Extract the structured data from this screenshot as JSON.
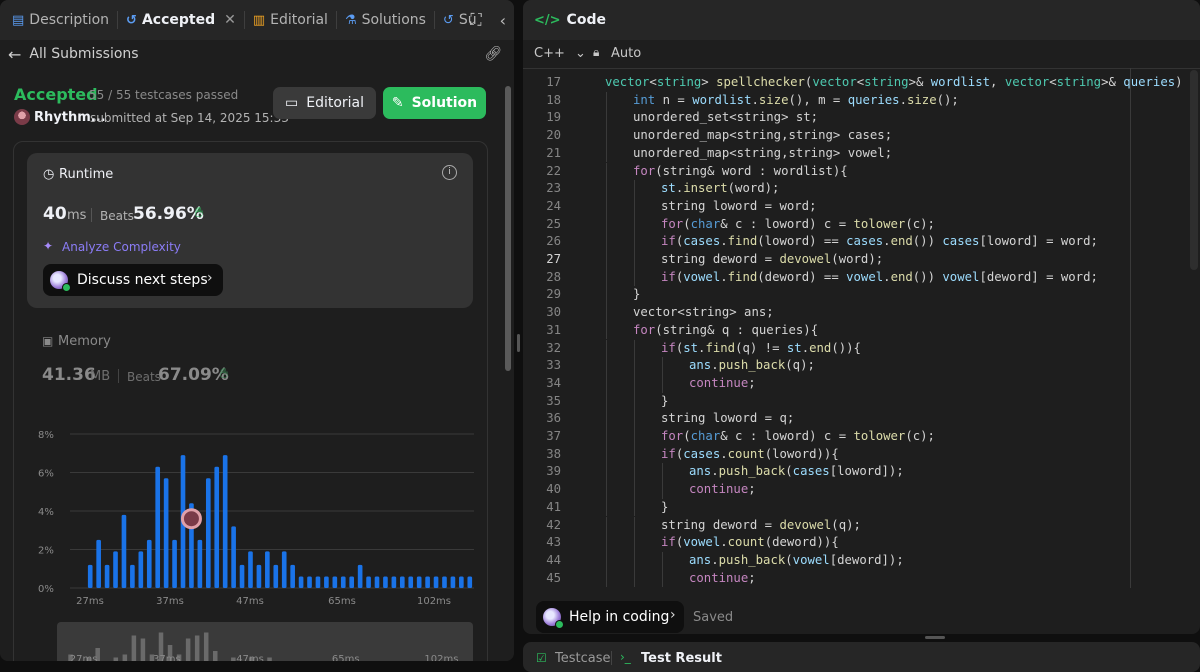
{
  "tabs": {
    "description": "Description",
    "accepted": "Accepted",
    "editorial": "Editorial",
    "solutions": "Solutions",
    "submissions": "Su"
  },
  "left": {
    "back_label": "All Submissions",
    "status": "Accepted",
    "testcases": "55 / 55 testcases passed",
    "user": "Rhythm...",
    "submitted_at": "submitted at Sep 14, 2025 15:33",
    "editorial_button": "Editorial",
    "solution_button": "Solution",
    "runtime": {
      "title": "Runtime",
      "value": "40",
      "unit": "ms",
      "beats_label": "Beats",
      "beats_value": "56.96%",
      "analyze": "Analyze Complexity",
      "discuss": "Discuss next steps"
    },
    "memory": {
      "title": "Memory",
      "value": "41.36",
      "unit": "MB",
      "beats_label": "Beats",
      "beats_value": "67.09%"
    }
  },
  "chart_data": {
    "type": "bar",
    "ylabel": "",
    "xlabel": "",
    "y_ticks": [
      "8%",
      "6%",
      "4%",
      "2%",
      "0%"
    ],
    "ylim": [
      0,
      8
    ],
    "x_ticks": [
      "27ms",
      "37ms",
      "47ms",
      "65ms",
      "102ms"
    ],
    "values": [
      1.2,
      2.5,
      1.2,
      1.9,
      3.8,
      1.2,
      1.9,
      2.5,
      6.3,
      5.7,
      2.5,
      6.9,
      4.4,
      2.5,
      5.7,
      6.3,
      6.9,
      3.2,
      1.2,
      1.9,
      1.2,
      1.9,
      1.2,
      1.9,
      1.2,
      0.6,
      0.6,
      0.6,
      0.6,
      0.6,
      0.6,
      0.6,
      1.2,
      0.6,
      0.6,
      0.6,
      0.6,
      0.6,
      0.6,
      0.6,
      0.6,
      0.6,
      0.6,
      0.6,
      0.6,
      0.6
    ],
    "highlight_index": 15,
    "color": "#1a73e8"
  },
  "code_panel": {
    "title": "Code",
    "language": "C++",
    "mode": "Auto",
    "help": "Help in coding",
    "saved": "Saved",
    "current_line": 27,
    "lines": [
      {
        "n": 17,
        "indent": 1,
        "tokens": [
          [
            "ty",
            "vector"
          ],
          [
            "pl",
            "<"
          ],
          [
            "ty",
            "string"
          ],
          [
            "pl",
            "> "
          ],
          [
            "fn",
            "spellchecker"
          ],
          [
            "pl",
            "("
          ],
          [
            "ty",
            "vector"
          ],
          [
            "pl",
            "<"
          ],
          [
            "ty",
            "string"
          ],
          [
            "pl",
            ">& "
          ],
          [
            "vr",
            "wordlist"
          ],
          [
            "pl",
            ", "
          ],
          [
            "ty",
            "vector"
          ],
          [
            "pl",
            "<"
          ],
          [
            "ty",
            "string"
          ],
          [
            "pl",
            ">& "
          ],
          [
            "vr",
            "queries"
          ],
          [
            "pl",
            ") {"
          ]
        ]
      },
      {
        "n": 18,
        "indent": 2,
        "tokens": [
          [
            "kw",
            "int"
          ],
          [
            "pl",
            " n = "
          ],
          [
            "vr",
            "wordlist"
          ],
          [
            "pl",
            "."
          ],
          [
            "fn",
            "size"
          ],
          [
            "pl",
            "(), m = "
          ],
          [
            "vr",
            "queries"
          ],
          [
            "pl",
            "."
          ],
          [
            "fn",
            "size"
          ],
          [
            "pl",
            "();"
          ]
        ]
      },
      {
        "n": 19,
        "indent": 2,
        "tokens": [
          [
            "pl",
            "unordered_set<string> st;"
          ]
        ]
      },
      {
        "n": 20,
        "indent": 2,
        "tokens": [
          [
            "pl",
            "unordered_map<string,string> cases;"
          ]
        ]
      },
      {
        "n": 21,
        "indent": 2,
        "tokens": [
          [
            "pl",
            "unordered_map<string,string> vowel;"
          ]
        ]
      },
      {
        "n": 22,
        "indent": 2,
        "tokens": [
          [
            "ct",
            "for"
          ],
          [
            "pl",
            "(string& word : wordlist){"
          ]
        ]
      },
      {
        "n": 23,
        "indent": 3,
        "tokens": [
          [
            "vr",
            "st"
          ],
          [
            "pl",
            "."
          ],
          [
            "fn",
            "insert"
          ],
          [
            "pl",
            "(word);"
          ]
        ]
      },
      {
        "n": 24,
        "indent": 3,
        "tokens": [
          [
            "pl",
            "string loword = word;"
          ]
        ]
      },
      {
        "n": 25,
        "indent": 3,
        "tokens": [
          [
            "ct",
            "for"
          ],
          [
            "pl",
            "("
          ],
          [
            "kw",
            "char"
          ],
          [
            "pl",
            "& c : loword) c = "
          ],
          [
            "fn",
            "tolower"
          ],
          [
            "pl",
            "(c);"
          ]
        ]
      },
      {
        "n": 26,
        "indent": 3,
        "tokens": [
          [
            "ct",
            "if"
          ],
          [
            "pl",
            "("
          ],
          [
            "vr",
            "cases"
          ],
          [
            "pl",
            "."
          ],
          [
            "fn",
            "find"
          ],
          [
            "pl",
            "(loword) == "
          ],
          [
            "vr",
            "cases"
          ],
          [
            "pl",
            "."
          ],
          [
            "fn",
            "end"
          ],
          [
            "pl",
            "()) "
          ],
          [
            "vr",
            "cases"
          ],
          [
            "pl",
            "[loword] = word;"
          ]
        ]
      },
      {
        "n": 27,
        "indent": 3,
        "tokens": [
          [
            "pl",
            "string deword = "
          ],
          [
            "fn",
            "devowel"
          ],
          [
            "pl",
            "(word);"
          ]
        ]
      },
      {
        "n": 28,
        "indent": 3,
        "tokens": [
          [
            "ct",
            "if"
          ],
          [
            "pl",
            "("
          ],
          [
            "vr",
            "vowel"
          ],
          [
            "pl",
            "."
          ],
          [
            "fn",
            "find"
          ],
          [
            "pl",
            "(deword) == "
          ],
          [
            "vr",
            "vowel"
          ],
          [
            "pl",
            "."
          ],
          [
            "fn",
            "end"
          ],
          [
            "pl",
            "()) "
          ],
          [
            "vr",
            "vowel"
          ],
          [
            "pl",
            "[deword] = word;"
          ]
        ]
      },
      {
        "n": 29,
        "indent": 2,
        "tokens": [
          [
            "pl",
            "}"
          ]
        ]
      },
      {
        "n": 30,
        "indent": 2,
        "tokens": [
          [
            "pl",
            "vector<string> ans;"
          ]
        ]
      },
      {
        "n": 31,
        "indent": 2,
        "tokens": [
          [
            "ct",
            "for"
          ],
          [
            "pl",
            "(string& q : queries){"
          ]
        ]
      },
      {
        "n": 32,
        "indent": 3,
        "tokens": [
          [
            "ct",
            "if"
          ],
          [
            "pl",
            "("
          ],
          [
            "vr",
            "st"
          ],
          [
            "pl",
            "."
          ],
          [
            "fn",
            "find"
          ],
          [
            "pl",
            "(q) != "
          ],
          [
            "vr",
            "st"
          ],
          [
            "pl",
            "."
          ],
          [
            "fn",
            "end"
          ],
          [
            "pl",
            "()){"
          ]
        ]
      },
      {
        "n": 33,
        "indent": 4,
        "tokens": [
          [
            "vr",
            "ans"
          ],
          [
            "pl",
            "."
          ],
          [
            "fn",
            "push_back"
          ],
          [
            "pl",
            "(q);"
          ]
        ]
      },
      {
        "n": 34,
        "indent": 4,
        "tokens": [
          [
            "ct",
            "continue"
          ],
          [
            "pl",
            ";"
          ]
        ]
      },
      {
        "n": 35,
        "indent": 3,
        "tokens": [
          [
            "pl",
            "}"
          ]
        ]
      },
      {
        "n": 36,
        "indent": 3,
        "tokens": [
          [
            "pl",
            "string loword = q;"
          ]
        ]
      },
      {
        "n": 37,
        "indent": 3,
        "tokens": [
          [
            "ct",
            "for"
          ],
          [
            "pl",
            "("
          ],
          [
            "kw",
            "char"
          ],
          [
            "pl",
            "& c : loword) c = "
          ],
          [
            "fn",
            "tolower"
          ],
          [
            "pl",
            "(c);"
          ]
        ]
      },
      {
        "n": 38,
        "indent": 3,
        "tokens": [
          [
            "ct",
            "if"
          ],
          [
            "pl",
            "("
          ],
          [
            "vr",
            "cases"
          ],
          [
            "pl",
            "."
          ],
          [
            "fn",
            "count"
          ],
          [
            "pl",
            "(loword)){"
          ]
        ]
      },
      {
        "n": 39,
        "indent": 4,
        "tokens": [
          [
            "vr",
            "ans"
          ],
          [
            "pl",
            "."
          ],
          [
            "fn",
            "push_back"
          ],
          [
            "pl",
            "("
          ],
          [
            "vr",
            "cases"
          ],
          [
            "pl",
            "[loword]);"
          ]
        ]
      },
      {
        "n": 40,
        "indent": 4,
        "tokens": [
          [
            "ct",
            "continue"
          ],
          [
            "pl",
            ";"
          ]
        ]
      },
      {
        "n": 41,
        "indent": 3,
        "tokens": [
          [
            "pl",
            "}"
          ]
        ]
      },
      {
        "n": 42,
        "indent": 3,
        "tokens": [
          [
            "pl",
            "string deword = "
          ],
          [
            "fn",
            "devowel"
          ],
          [
            "pl",
            "(q);"
          ]
        ]
      },
      {
        "n": 43,
        "indent": 3,
        "tokens": [
          [
            "ct",
            "if"
          ],
          [
            "pl",
            "("
          ],
          [
            "vr",
            "vowel"
          ],
          [
            "pl",
            "."
          ],
          [
            "fn",
            "count"
          ],
          [
            "pl",
            "(deword)){"
          ]
        ]
      },
      {
        "n": 44,
        "indent": 4,
        "tokens": [
          [
            "vr",
            "ans"
          ],
          [
            "pl",
            "."
          ],
          [
            "fn",
            "push_back"
          ],
          [
            "pl",
            "("
          ],
          [
            "vr",
            "vowel"
          ],
          [
            "pl",
            "[deword]);"
          ]
        ]
      },
      {
        "n": 45,
        "indent": 4,
        "tokens": [
          [
            "ct",
            "continue"
          ],
          [
            "pl",
            ";"
          ]
        ]
      }
    ]
  },
  "bottom": {
    "testcase": "Testcase",
    "test_result": "Test Result"
  }
}
